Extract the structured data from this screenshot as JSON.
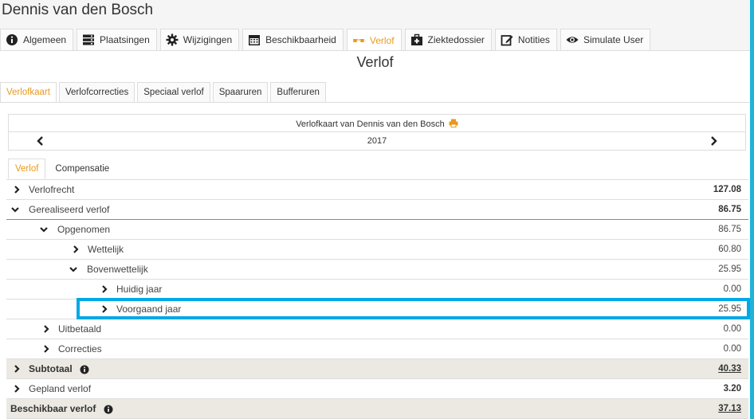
{
  "page": {
    "title": "Dennis van den Bosch"
  },
  "main_tabs": [
    {
      "label": "Algemeen",
      "icon": "info-circle-icon",
      "active": false
    },
    {
      "label": "Plaatsingen",
      "icon": "server-icon",
      "active": false
    },
    {
      "label": "Wijzigingen",
      "icon": "gear-icon",
      "active": false
    },
    {
      "label": "Beschikbaarheid",
      "icon": "calendar-icon",
      "active": false
    },
    {
      "label": "Verlof",
      "icon": "sunglasses-icon",
      "active": true
    },
    {
      "label": "Ziektedossier",
      "icon": "medkit-icon",
      "active": false
    },
    {
      "label": "Notities",
      "icon": "edit-icon",
      "active": false
    },
    {
      "label": "Simulate User",
      "icon": "eye-icon",
      "active": false
    }
  ],
  "section": {
    "title": "Verlof"
  },
  "sub_tabs": [
    {
      "label": "Verlofkaart",
      "active": true
    },
    {
      "label": "Verlofcorrecties",
      "active": false
    },
    {
      "label": "Speciaal verlof",
      "active": false
    },
    {
      "label": "Spaaruren",
      "active": false
    },
    {
      "label": "Bufferuren",
      "active": false
    }
  ],
  "card": {
    "title": "Verlofkaart van Dennis van den Bosch",
    "year": "2017"
  },
  "inner_tabs": [
    {
      "label": "Verlof",
      "active": true
    },
    {
      "label": "Compensatie",
      "active": false
    }
  ],
  "rows": [
    {
      "label": "Verlofrecht",
      "value": "127.08",
      "expanded": false
    },
    {
      "label": "Gerealiseerd verlof",
      "value": "86.75",
      "expanded": true
    },
    {
      "label": "Opgenomen",
      "value": "86.75",
      "expanded": true
    },
    {
      "label": "Wettelijk",
      "value": "60.80",
      "expanded": false
    },
    {
      "label": "Bovenwettelijk",
      "value": "25.95",
      "expanded": true
    },
    {
      "label": "Huidig jaar",
      "value": "0.00",
      "expanded": false
    },
    {
      "label": "Voorgaand jaar",
      "value": "25.95",
      "expanded": false
    },
    {
      "label": "Uitbetaald",
      "value": "0.00",
      "expanded": false
    },
    {
      "label": "Correcties",
      "value": "0.00",
      "expanded": false
    },
    {
      "label": "Subtotaal",
      "value": "40.33",
      "expanded": false
    },
    {
      "label": "Gepland verlof",
      "value": "3.20",
      "expanded": false
    },
    {
      "label": "Beschikbaar verlof",
      "value": "37.13"
    }
  ],
  "colors": {
    "active_tab": "#e89a1e",
    "highlight": "#00a8e6",
    "subtotal_bg": "#ebe9e2"
  }
}
